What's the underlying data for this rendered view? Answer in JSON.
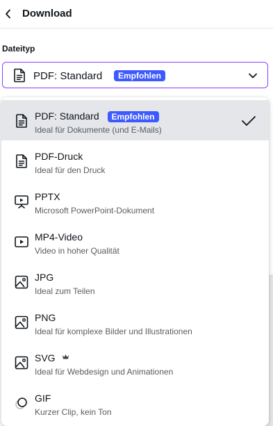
{
  "header": {
    "title": "Download"
  },
  "filetype": {
    "label": "Dateityp",
    "selected_label": "PDF: Standard",
    "selected_badge": "Empfohlen"
  },
  "menu": {
    "options": [
      {
        "title": "PDF: Standard",
        "badge": "Empfohlen",
        "description": "Ideal für Dokumente (und E-Mails)",
        "icon": "document-icon",
        "selected": true
      },
      {
        "title": "PDF-Druck",
        "description": "Ideal für den Druck",
        "icon": "document-icon"
      },
      {
        "title": "PPTX",
        "description": "Microsoft PowerPoint-Dokument",
        "icon": "presentation-icon"
      },
      {
        "title": "MP4-Video",
        "description": "Video in hoher Qualität",
        "icon": "video-icon"
      },
      {
        "title": "JPG",
        "description": "Ideal zum Teilen",
        "icon": "image-icon"
      },
      {
        "title": "PNG",
        "description": "Ideal für komplexe Bilder und Illustrationen",
        "icon": "image-icon"
      },
      {
        "title": "SVG",
        "description": "Ideal für Webdesign und Animationen",
        "icon": "image-icon",
        "premium_icon": "crown-icon"
      },
      {
        "title": "GIF",
        "description": "Kurzer Clip, kein Ton",
        "icon": "gif-icon"
      }
    ]
  },
  "colors": {
    "focus_border": "#8b3dff",
    "badge": "#3d5afe",
    "selected_row": "#e4e6e9",
    "text": "#0e1318",
    "muted_text": "#585c61"
  }
}
